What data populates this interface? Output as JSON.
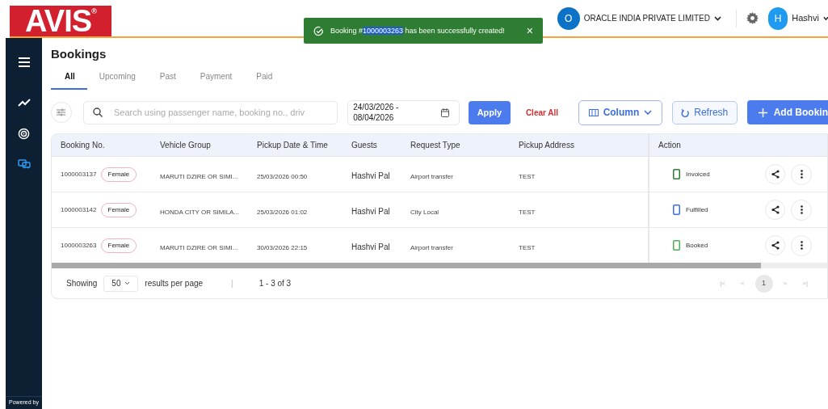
{
  "header": {
    "logo": "AVIS",
    "logo_mark": "®",
    "organization": {
      "initial": "O",
      "name": "ORACLE INDIA PRIVATE LIMITED"
    },
    "user": {
      "initial": "H",
      "name": "Hashvi"
    }
  },
  "toast": {
    "message_before": "Booking #",
    "selected_text": "1000003263",
    "message_after": " has been successfully created!",
    "close": "×"
  },
  "sidebar": {
    "items": [
      {
        "selected": false
      },
      {
        "selected": false
      },
      {
        "selected": false
      },
      {
        "selected": true
      }
    ],
    "footer": "Powered by"
  },
  "page": {
    "title": "Bookings"
  },
  "tabs": [
    {
      "label": "All",
      "selected": true
    },
    {
      "label": "Upcoming",
      "selected": false
    },
    {
      "label": "Past",
      "selected": false
    },
    {
      "label": "Payment",
      "selected": false
    },
    {
      "label": "Paid",
      "selected": false
    }
  ],
  "toolbar": {
    "search": {
      "placeholder": "Search using passenger name, booking no., driv"
    },
    "date_range": "24/03/2026 -\n08/04/2026",
    "apply": "Apply",
    "clear": "Clear All",
    "column": "Column",
    "refresh": "Refresh",
    "add": "Add Bookin"
  },
  "table": {
    "columns": [
      "Booking No.",
      "Vehicle Group",
      "Pickup Date & Time",
      "Guests",
      "Request Type",
      "Pickup Address",
      "Action"
    ],
    "rows": [
      {
        "booking_no": "1000003137",
        "tag": "Female",
        "vehicle_group": "MARUTI DZIRE OR SIMI...",
        "pickup": "25/03/2026 00:50",
        "guests": "Hashvi Pal",
        "request_type": "Airport transfer",
        "address": "TEST",
        "status": "Invoiced",
        "color": "#2e7d32"
      },
      {
        "booking_no": "1000003142",
        "tag": "Female",
        "vehicle_group": "HONDA CITY OR SIMILA...",
        "pickup": "25/03/2026 01:02",
        "guests": "Hashvi Pal",
        "request_type": "City Local",
        "address": "TEST",
        "status": "Fulfilled",
        "color": "#3b6fe0"
      },
      {
        "booking_no": "1000003263",
        "tag": "Female",
        "vehicle_group": "MARUTI DZIRE OR SIMI...",
        "pickup": "30/03/2026 22:15",
        "guests": "Hashvi Pal",
        "request_type": "Airport transfer",
        "address": "TEST",
        "status": "Booked",
        "color": "#4caf50"
      }
    ]
  },
  "footer": {
    "showing": "Showing",
    "page_size": "50",
    "per_page": "results per page",
    "separator": "|",
    "range": "1 - 3 of 3",
    "pages": [
      {
        "label": "1",
        "selected": true
      }
    ],
    "first": "|<",
    "prev": "<",
    "next": ">",
    "last": ">|"
  }
}
